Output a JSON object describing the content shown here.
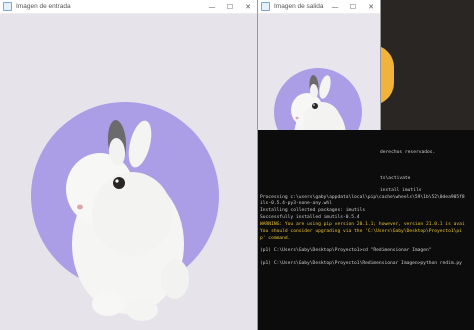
{
  "windows": {
    "input": {
      "title": "Imagen de entrada"
    },
    "output": {
      "title": "Imagen de salida"
    },
    "controls": {
      "minimize": "—",
      "maximize": "☐",
      "close": "✕"
    }
  },
  "terminal": {
    "lines": [
      {
        "text": "derechos reservados.",
        "warn": false
      },
      {
        "text": "ts\\activate",
        "warn": false
      },
      {
        "text": "install imutils",
        "warn": false
      },
      {
        "text": "Processing c:\\users\\gaby\\appdata\\local\\pip\\cache\\wheels\\59\\1b\\52\\0dea905f8",
        "warn": false
      },
      {
        "text": "ils-0.5.4-py3-none-any.whl",
        "warn": false
      },
      {
        "text": "Installing collected packages: imutils",
        "warn": false
      },
      {
        "text": "Successfully installed imutils-0.5.4",
        "warn": false
      },
      {
        "text": "WARNING: You are using pip version 20.1.1; however, version 21.0.1 is avai",
        "warn": true
      },
      {
        "text": "You should consider upgrading via the 'C:\\Users\\Gaby\\Desktop\\Proyecto1\\pi",
        "warn": true
      },
      {
        "text": "p' command.",
        "warn": true
      },
      {
        "text": "",
        "warn": false
      },
      {
        "text": "(p1) C:\\Users\\Gaby\\Desktop\\Proyecto1>cd \"Redimensionar Imagen\"",
        "warn": false
      },
      {
        "text": "",
        "warn": false
      },
      {
        "text": "(p1) C:\\Users\\Gaby\\Desktop\\Proyecto1\\Redimensionar Imagen>python redim.py",
        "warn": false
      }
    ]
  },
  "colors": {
    "circle": "#ab9de6",
    "canvas_bg": "#e6e4ea",
    "terminal_bg": "#0c0c0c",
    "terminal_text": "#cfcfcf",
    "terminal_warn": "#e8c232",
    "accent_orange": "#f0b33c"
  }
}
